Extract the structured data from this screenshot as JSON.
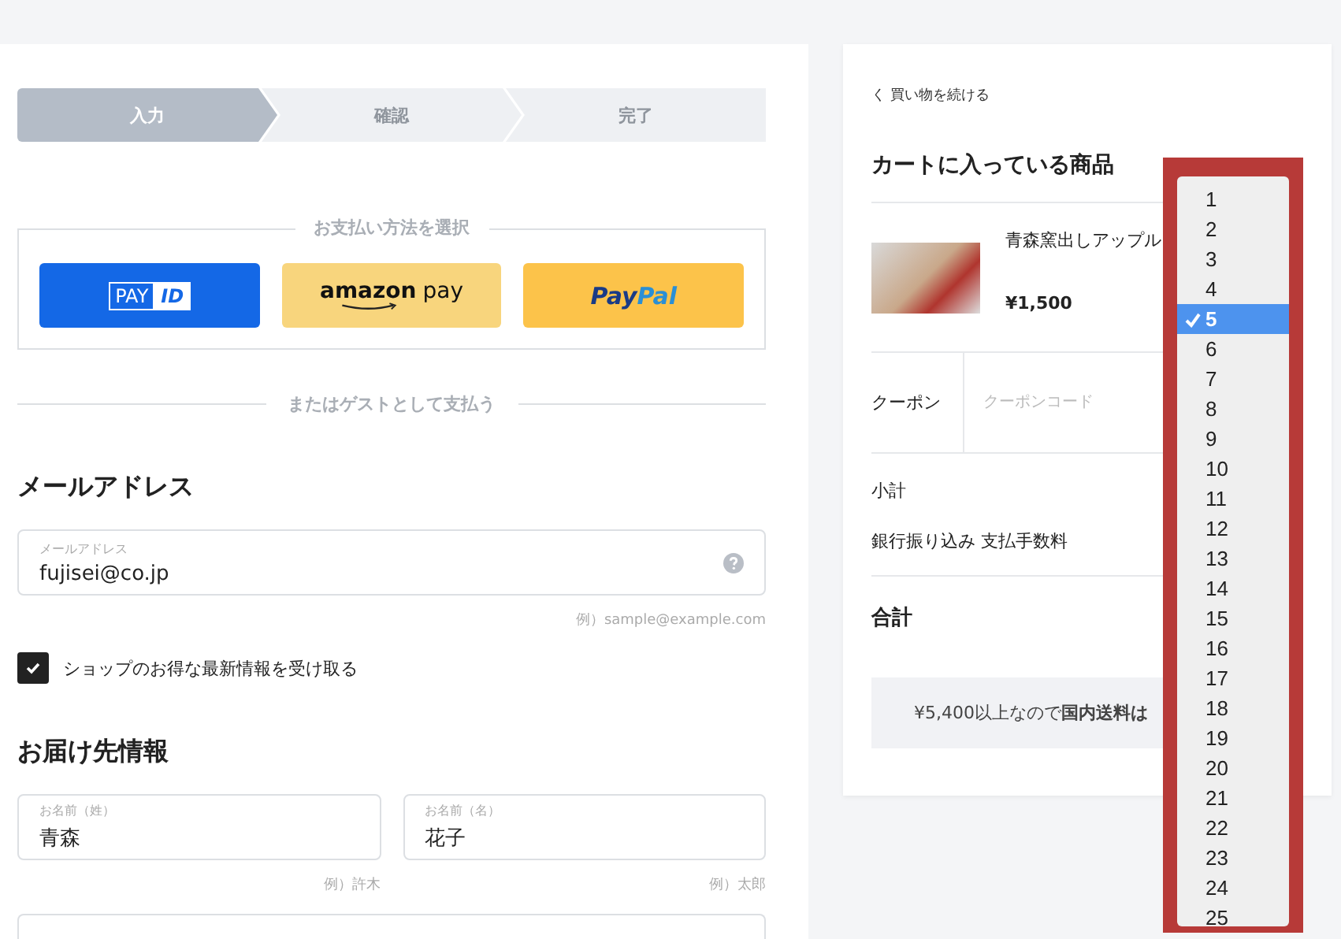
{
  "steps": [
    {
      "label": "入力",
      "selected": true
    },
    {
      "label": "確認",
      "selected": false
    },
    {
      "label": "完了",
      "selected": false
    }
  ],
  "payment": {
    "title": "お支払い方法を選択",
    "buttons": [
      {
        "kind": "payid",
        "parts": [
          "PAY",
          "ID"
        ]
      },
      {
        "kind": "amazon",
        "parts": [
          "amazon",
          "pay"
        ]
      },
      {
        "kind": "paypal",
        "parts": [
          "Pay",
          "Pal"
        ]
      }
    ]
  },
  "guest_divider": "またはゲストとして支払う",
  "email": {
    "heading": "メールアドレス",
    "label": "メールアドレス",
    "value": "fujisei@co.jp",
    "hint": "例）sample@example.com"
  },
  "newsletter": {
    "label": "ショップのお得な最新情報を受け取る",
    "checked": true
  },
  "shipping": {
    "heading": "お届け先情報",
    "fields": [
      {
        "label": "お名前（姓）",
        "value": "青森",
        "hint": "例）許木"
      },
      {
        "label": "お名前（名）",
        "value": "花子",
        "hint": "例）太郎"
      }
    ]
  },
  "cart": {
    "back_link": "く 買い物を続ける",
    "heading": "カートに入っている商品",
    "item": {
      "name": "青森窯出しアップル",
      "price": "¥1,500"
    },
    "coupon": {
      "label": "クーポン",
      "placeholder": "クーポンコード"
    },
    "rows": [
      {
        "label": "小計"
      },
      {
        "label": "銀行振り込み 支払手数料"
      }
    ],
    "total_label": "合計",
    "banner": "¥5,400以上なので**国内送料は**"
  },
  "quantity_menu": [
    {
      "label": "1",
      "selected": false
    },
    {
      "label": "2",
      "selected": false
    },
    {
      "label": "3",
      "selected": false
    },
    {
      "label": "4",
      "selected": false
    },
    {
      "label": "5",
      "selected": true
    },
    {
      "label": "6",
      "selected": false
    },
    {
      "label": "7",
      "selected": false
    },
    {
      "label": "8",
      "selected": false
    },
    {
      "label": "9",
      "selected": false
    },
    {
      "label": "10",
      "selected": false
    },
    {
      "label": "11",
      "selected": false
    },
    {
      "label": "12",
      "selected": false
    },
    {
      "label": "13",
      "selected": false
    },
    {
      "label": "14",
      "selected": false
    },
    {
      "label": "15",
      "selected": false
    },
    {
      "label": "16",
      "selected": false
    },
    {
      "label": "17",
      "selected": false
    },
    {
      "label": "18",
      "selected": false
    },
    {
      "label": "19",
      "selected": false
    },
    {
      "label": "20",
      "selected": false
    },
    {
      "label": "21",
      "selected": false
    },
    {
      "label": "22",
      "selected": false
    },
    {
      "label": "23",
      "selected": false
    },
    {
      "label": "24",
      "selected": false
    },
    {
      "label": "25",
      "selected": false
    }
  ]
}
